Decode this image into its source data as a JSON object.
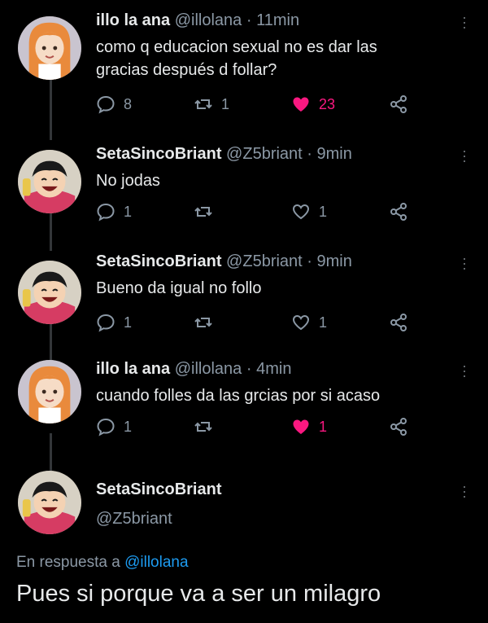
{
  "tweets": [
    {
      "name": "illo la ana",
      "handle": "@illolana",
      "sep": "·",
      "time": "11min",
      "line1": "como q educacion sexual no es dar las",
      "line2": "gracias después d follar?",
      "replies": "8",
      "retweets": "1",
      "likes": "23",
      "liked": true,
      "avatar": "orange-hair-character"
    },
    {
      "name": "SetaSincoBriant",
      "handle": "@Z5briant",
      "sep": "·",
      "time": "9min",
      "line1": "No jodas",
      "replies": "1",
      "retweets": "",
      "likes": "1",
      "liked": false,
      "avatar": "straw-hat-character"
    },
    {
      "name": "SetaSincoBriant",
      "handle": "@Z5briant",
      "sep": "·",
      "time": "9min",
      "line1": "Bueno da igual no follo",
      "replies": "1",
      "retweets": "",
      "likes": "1",
      "liked": false,
      "avatar": "straw-hat-character"
    },
    {
      "name": "illo la ana",
      "handle": "@illolana",
      "sep": "·",
      "time": "4min",
      "line1": "cuando folles da las grcias por si acaso",
      "replies": "1",
      "retweets": "",
      "likes": "1",
      "liked": true,
      "avatar": "orange-hair-character"
    }
  ],
  "main_tweet": {
    "name": "SetaSincoBriant",
    "handle": "@Z5briant",
    "reply_prefix": "En respuesta a",
    "reply_handle": "@illolana",
    "text": "Pues si porque va a ser un milagro"
  },
  "colors": {
    "background": "#000000",
    "text": "#e7e9ea",
    "muted": "#8b98a5",
    "like": "#f91880",
    "link": "#1d9bf0"
  }
}
